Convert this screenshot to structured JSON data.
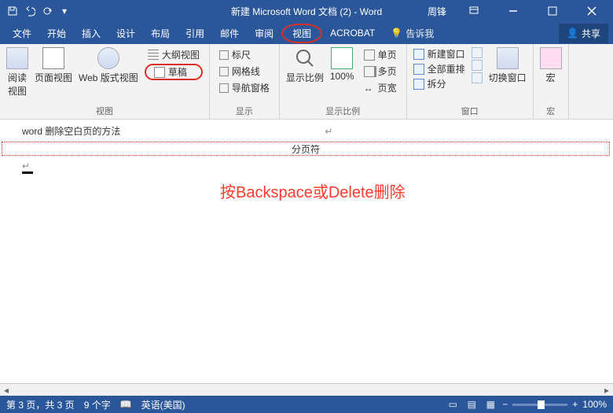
{
  "title": "新建 Microsoft Word 文档 (2) - Word",
  "user": "周锋",
  "menu": {
    "file": "文件",
    "home": "开始",
    "insert": "插入",
    "design": "设计",
    "layout": "布局",
    "ref": "引用",
    "mail": "邮件",
    "review": "审阅",
    "view": "视图",
    "acrobat": "ACROBAT",
    "tellme": "告诉我",
    "share": "共享"
  },
  "ribbon": {
    "views": {
      "read": "阅读\n视图",
      "page": "页面视图",
      "web": "Web 版式视图",
      "outline": "大纲视图",
      "draft": "草稿",
      "group": "视图"
    },
    "show": {
      "ruler": "标尺",
      "grid": "网格线",
      "nav": "导航窗格",
      "group": "显示"
    },
    "zoom": {
      "zoom": "显示比例",
      "p100": "100%",
      "onepage": "单页",
      "multipage": "多页",
      "pagewidth": "页宽",
      "group": "显示比例"
    },
    "window": {
      "newwin": "新建窗口",
      "arrange": "全部重排",
      "split": "拆分",
      "switch": "切换窗口",
      "group": "窗口"
    },
    "macro": {
      "macro": "宏",
      "group": "宏"
    }
  },
  "doc": {
    "line1": "word 删除空白页的方法",
    "pagebreak": "分页符",
    "annot": "按Backspace或Delete删除"
  },
  "status": {
    "page": "第 3 页，共 3 页",
    "words": "9 个字",
    "lang": "英语(美国)",
    "zoom": "100%"
  }
}
